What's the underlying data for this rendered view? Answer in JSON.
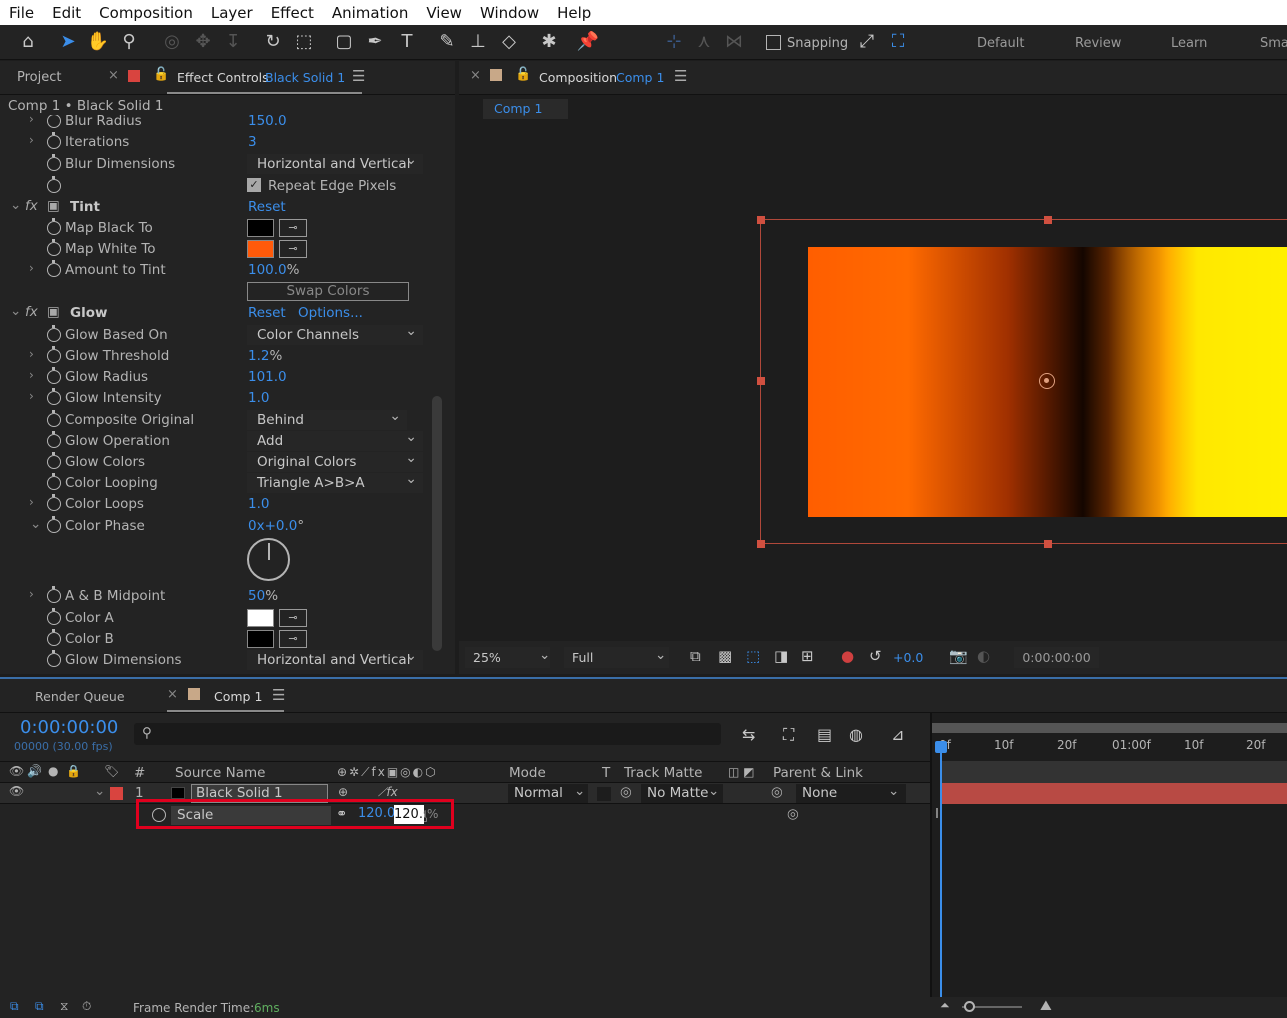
{
  "menu": [
    "File",
    "Edit",
    "Composition",
    "Layer",
    "Effect",
    "Animation",
    "View",
    "Window",
    "Help"
  ],
  "toolbar": {
    "snapping": "Snapping",
    "workspaces": [
      "Default",
      "Review",
      "Learn",
      "Sma"
    ]
  },
  "left_panel": {
    "tab_project": "Project",
    "tab_effect": "Effect Controls",
    "tab_effect_layer": "Black Solid 1",
    "breadcrumb": "Comp 1 • Black Solid 1",
    "rows": {
      "blur_radius": {
        "name": "Blur Radius",
        "value": "150.0"
      },
      "iterations": {
        "name": "Iterations",
        "value": "3"
      },
      "blur_dimensions": {
        "name": "Blur Dimensions",
        "value": "Horizontal and Vertical"
      },
      "repeat_edge": "Repeat Edge Pixels",
      "tint": {
        "name": "Tint",
        "reset": "Reset"
      },
      "map_black": "Map Black To",
      "map_white": "Map White To",
      "amount_tint": {
        "name": "Amount to Tint",
        "value": "100.0",
        "unit": "%"
      },
      "swap_colors": "Swap Colors",
      "glow": {
        "name": "Glow",
        "reset": "Reset",
        "options": "Options..."
      },
      "glow_based_on": {
        "name": "Glow Based On",
        "value": "Color Channels"
      },
      "glow_threshold": {
        "name": "Glow Threshold",
        "value": "1.2",
        "unit": "%"
      },
      "glow_radius": {
        "name": "Glow Radius",
        "value": "101.0"
      },
      "glow_intensity": {
        "name": "Glow Intensity",
        "value": "1.0"
      },
      "composite_original": {
        "name": "Composite Original",
        "value": "Behind"
      },
      "glow_operation": {
        "name": "Glow Operation",
        "value": "Add"
      },
      "glow_colors": {
        "name": "Glow Colors",
        "value": "Original Colors"
      },
      "color_looping": {
        "name": "Color Looping",
        "value": "Triangle A>B>A"
      },
      "color_loops": {
        "name": "Color Loops",
        "value": "1.0"
      },
      "color_phase": {
        "name": "Color Phase",
        "value": "0x+0.0",
        "unit": "°"
      },
      "ab_midpoint": {
        "name": "A & B Midpoint",
        "value": "50",
        "unit": "%"
      },
      "color_a": "Color A",
      "color_b": "Color B",
      "glow_dimensions": {
        "name": "Glow Dimensions",
        "value": "Horizontal and Vertical"
      }
    },
    "colors": {
      "map_black": "#000000",
      "map_white": "#ff5a0a",
      "color_a": "#ffffff",
      "color_b": "#000000"
    }
  },
  "comp_panel": {
    "tab": "Composition",
    "tab_comp": "Comp 1",
    "subtab": "Comp 1",
    "zoom": "25%",
    "resolution": "Full",
    "exposure": "+0.0",
    "timecode": "0:00:00:00"
  },
  "timeline": {
    "tab_render": "Render Queue",
    "tab_comp": "Comp 1",
    "timecode": "0:00:00:00",
    "fps": "00000 (30.00 fps)",
    "search_placeholder": "",
    "headers": {
      "num": "#",
      "source": "Source Name",
      "mode": "Mode",
      "t": "T",
      "track_matte": "Track Matte",
      "parent": "Parent & Link"
    },
    "layer": {
      "num": "1",
      "name": "Black Solid 1",
      "mode": "Normal",
      "matte": "No Matte",
      "parent": "None"
    },
    "scale": {
      "name": "Scale",
      "value1": "120.0",
      "value2": "120.0",
      "unit": "%"
    },
    "ruler": [
      "0f",
      "10f",
      "20f",
      "01:00f",
      "10f",
      "20f"
    ],
    "footer": {
      "label": "Frame Render Time:",
      "value": "6ms"
    }
  }
}
